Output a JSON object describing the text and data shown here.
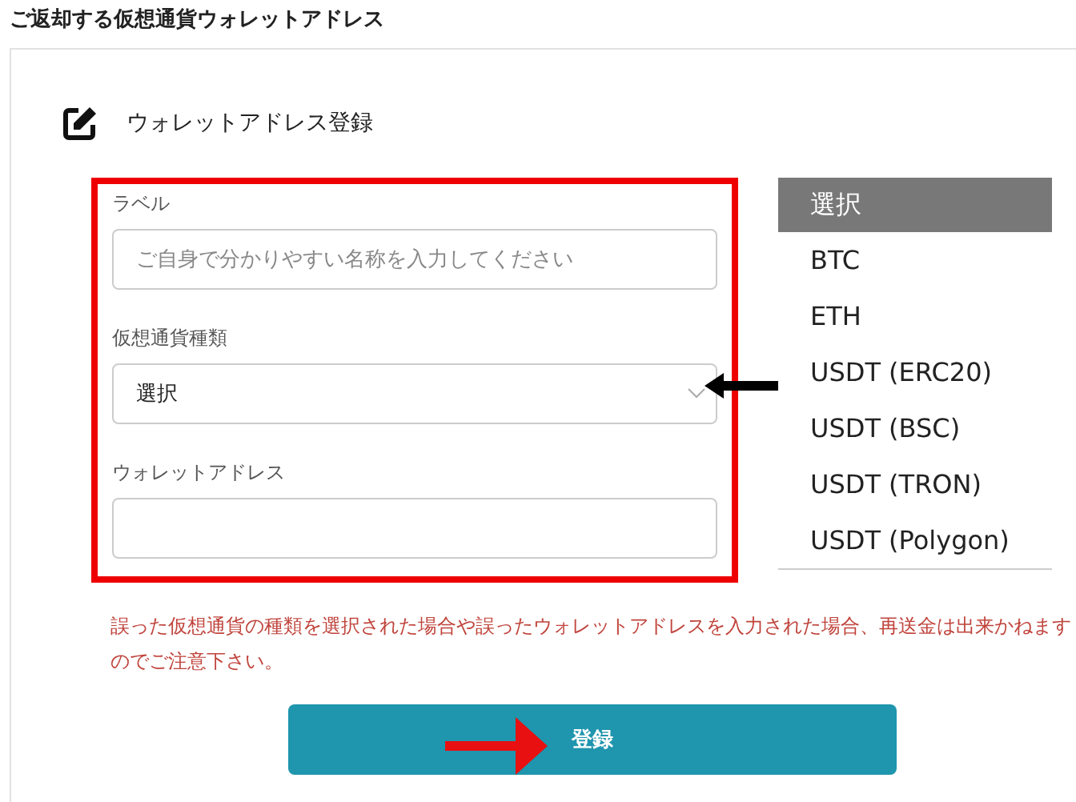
{
  "page_title": "ご返却する仮想通貨ウォレットアドレス",
  "form": {
    "heading": "ウォレットアドレス登録",
    "label_field": {
      "label": "ラベル",
      "placeholder": "ご自身で分かりやすい名称を入力してください"
    },
    "currency_field": {
      "label": "仮想通貨種類",
      "value": "選択"
    },
    "address_field": {
      "label": "ウォレットアドレス"
    }
  },
  "currency_options": [
    {
      "label": "選択",
      "selected": true
    },
    {
      "label": "BTC",
      "selected": false
    },
    {
      "label": "ETH",
      "selected": false
    },
    {
      "label": "USDT (ERC20)",
      "selected": false
    },
    {
      "label": "USDT (BSC)",
      "selected": false
    },
    {
      "label": "USDT (TRON)",
      "selected": false
    },
    {
      "label": "USDT (Polygon)",
      "selected": false
    }
  ],
  "warning": "誤った仮想通貨の種類を選択された場合や誤ったウォレットアドレスを入力された場合、再送金は出来かねますのでご注意下さい。",
  "submit_button": "登録"
}
